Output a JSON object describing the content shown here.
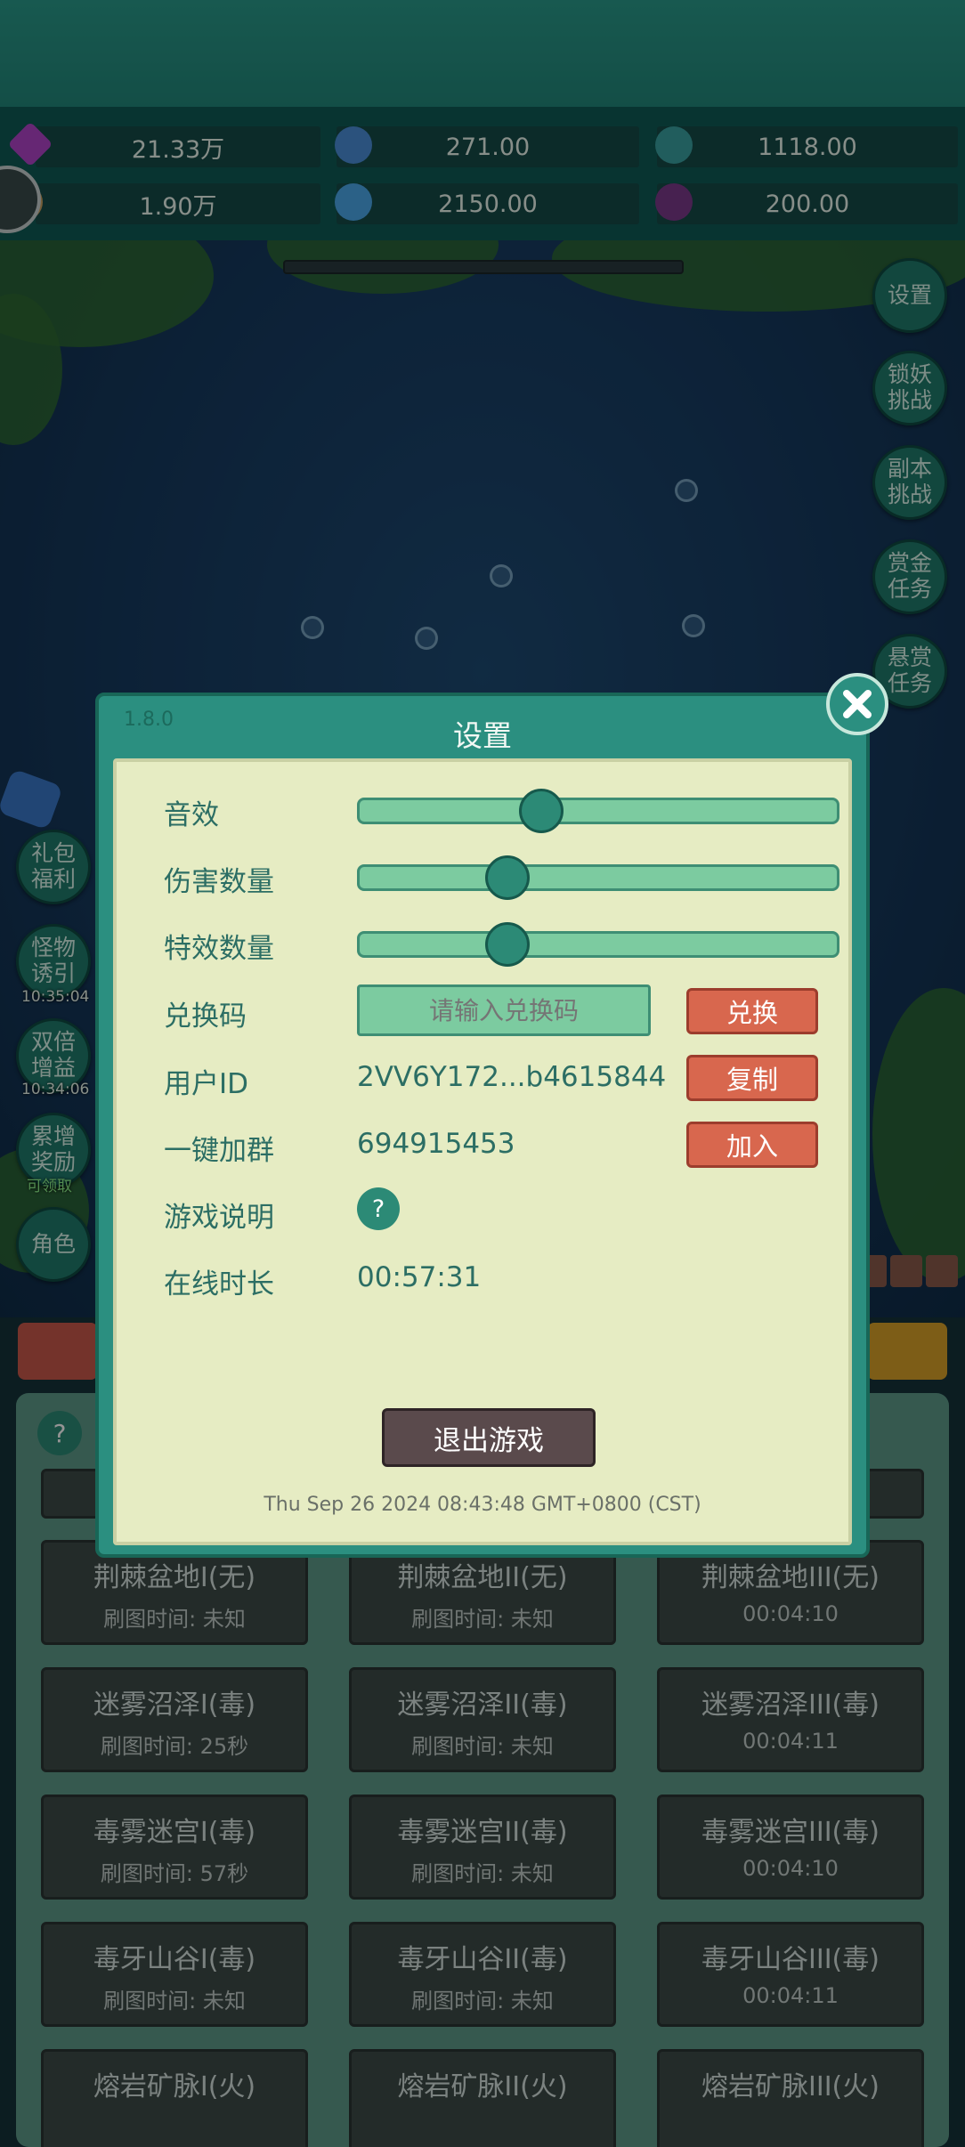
{
  "resources": [
    {
      "icon": "purple-gem-icon",
      "value": "21.33万",
      "color": "#b044c8"
    },
    {
      "icon": "blue-crystal-icon",
      "value": "271.00",
      "color": "#4a8ed8"
    },
    {
      "icon": "fish-coin-icon",
      "value": "1118.00",
      "color": "#3aa0a0"
    },
    {
      "icon": "shell-icon",
      "value": "1.90万",
      "color": "#c8a060"
    },
    {
      "icon": "ice-crystal-icon",
      "value": "2150.00",
      "color": "#4aa8e8"
    },
    {
      "icon": "purple-orb-icon",
      "value": "200.00",
      "color": "#7a3a8a"
    }
  ],
  "right_menu": [
    "设置",
    "锁妖挑战",
    "副本挑战",
    "赏金任务",
    "悬赏任务"
  ],
  "left_menu": [
    "礼包福利",
    "怪物诱引",
    "双倍增益",
    "累增奖励",
    "角色"
  ],
  "left_timers": [
    "10:35:04",
    "10:34:06",
    "可领取"
  ],
  "dialog": {
    "version": "1.8.0",
    "title": "设置",
    "sound_label": "音效",
    "sound_level": 0.38,
    "damage_label": "伤害数量",
    "damage_level": 0.31,
    "effects_label": "特效数量",
    "effects_level": 0.31,
    "redeem_label": "兑换码",
    "redeem_placeholder": "请输入兑换码",
    "redeem_button": "兑换",
    "userid_label": "用户ID",
    "userid_value": "2VV6Y172...b4615844",
    "copy_button": "复制",
    "group_label": "一键加群",
    "group_value": "694915453",
    "join_button": "加入",
    "help_label": "游戏说明",
    "help_icon": "?",
    "online_label": "在线时长",
    "online_value": "00:57:31",
    "exit_button": "退出游戏",
    "timestamp": "Thu Sep 26 2024 08:43:48 GMT+0800 (CST)"
  },
  "panel_help": "?",
  "stages": [
    [
      {
        "name": "荆棘盆地I(无)",
        "time": "刷图时间: 未知"
      },
      {
        "name": "荆棘盆地II(无)",
        "time": "刷图时间: 未知"
      },
      {
        "name": "荆棘盆地III(无)",
        "time": "00:04:10"
      }
    ],
    [
      {
        "name": "迷雾沼泽I(毒)",
        "time": "刷图时间: 25秒"
      },
      {
        "name": "迷雾沼泽II(毒)",
        "time": "刷图时间: 未知"
      },
      {
        "name": "迷雾沼泽III(毒)",
        "time": "00:04:11"
      }
    ],
    [
      {
        "name": "毒雾迷宫I(毒)",
        "time": "刷图时间: 57秒"
      },
      {
        "name": "毒雾迷宫II(毒)",
        "time": "刷图时间: 未知"
      },
      {
        "name": "毒雾迷宫III(毒)",
        "time": "00:04:10"
      }
    ],
    [
      {
        "name": "毒牙山谷I(毒)",
        "time": "刷图时间: 未知"
      },
      {
        "name": "毒牙山谷II(毒)",
        "time": "刷图时间: 未知"
      },
      {
        "name": "毒牙山谷III(毒)",
        "time": "00:04:11"
      }
    ],
    [
      {
        "name": "熔岩矿脉I(火)",
        "time": ""
      },
      {
        "name": "熔岩矿脉II(火)",
        "time": ""
      },
      {
        "name": "熔岩矿脉III(火)",
        "time": ""
      }
    ]
  ]
}
